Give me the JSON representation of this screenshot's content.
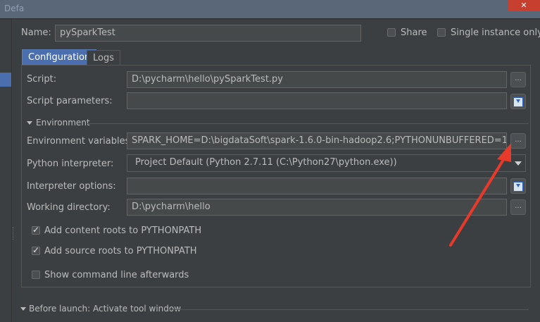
{
  "window": {
    "title": "Defa"
  },
  "header": {
    "name_label": "Name:",
    "name_value": "pySparkTest",
    "share_label": "Share",
    "single_instance_label": "Single instance only"
  },
  "tabs": [
    {
      "label": "Configuration"
    },
    {
      "label": "Logs"
    }
  ],
  "config": {
    "script_label": "Script:",
    "script_value": "D:\\pycharm\\hello\\pySparkTest.py",
    "script_params_label": "Script parameters:",
    "script_params_value": "",
    "environment_section": "Environment",
    "env_vars_label": "Environment variables:",
    "env_vars_value": "SPARK_HOME=D:\\bigdataSoft\\spark-1.6.0-bin-hadoop2.6;PYTHONUNBUFFERED=1",
    "interpreter_label": "Python interpreter:",
    "interpreter_value": "Project Default (Python 2.7.11 (C:\\Python27\\python.exe))",
    "interp_options_label": "Interpreter options:",
    "interp_options_value": "",
    "working_dir_label": "Working directory:",
    "working_dir_value": "D:\\pycharm\\hello",
    "browse_glyph": "...",
    "add_content_roots": {
      "label": "Add content roots to PYTHONPATH",
      "checked": true
    },
    "add_source_roots": {
      "label": "Add source roots to PYTHONPATH",
      "checked": true
    },
    "show_cmd_line": {
      "label": "Show command line afterwards",
      "checked": false
    }
  },
  "footer": {
    "before_launch_label": "Before launch: Activate tool window"
  },
  "annotation": {
    "color": "#e83a2a"
  }
}
